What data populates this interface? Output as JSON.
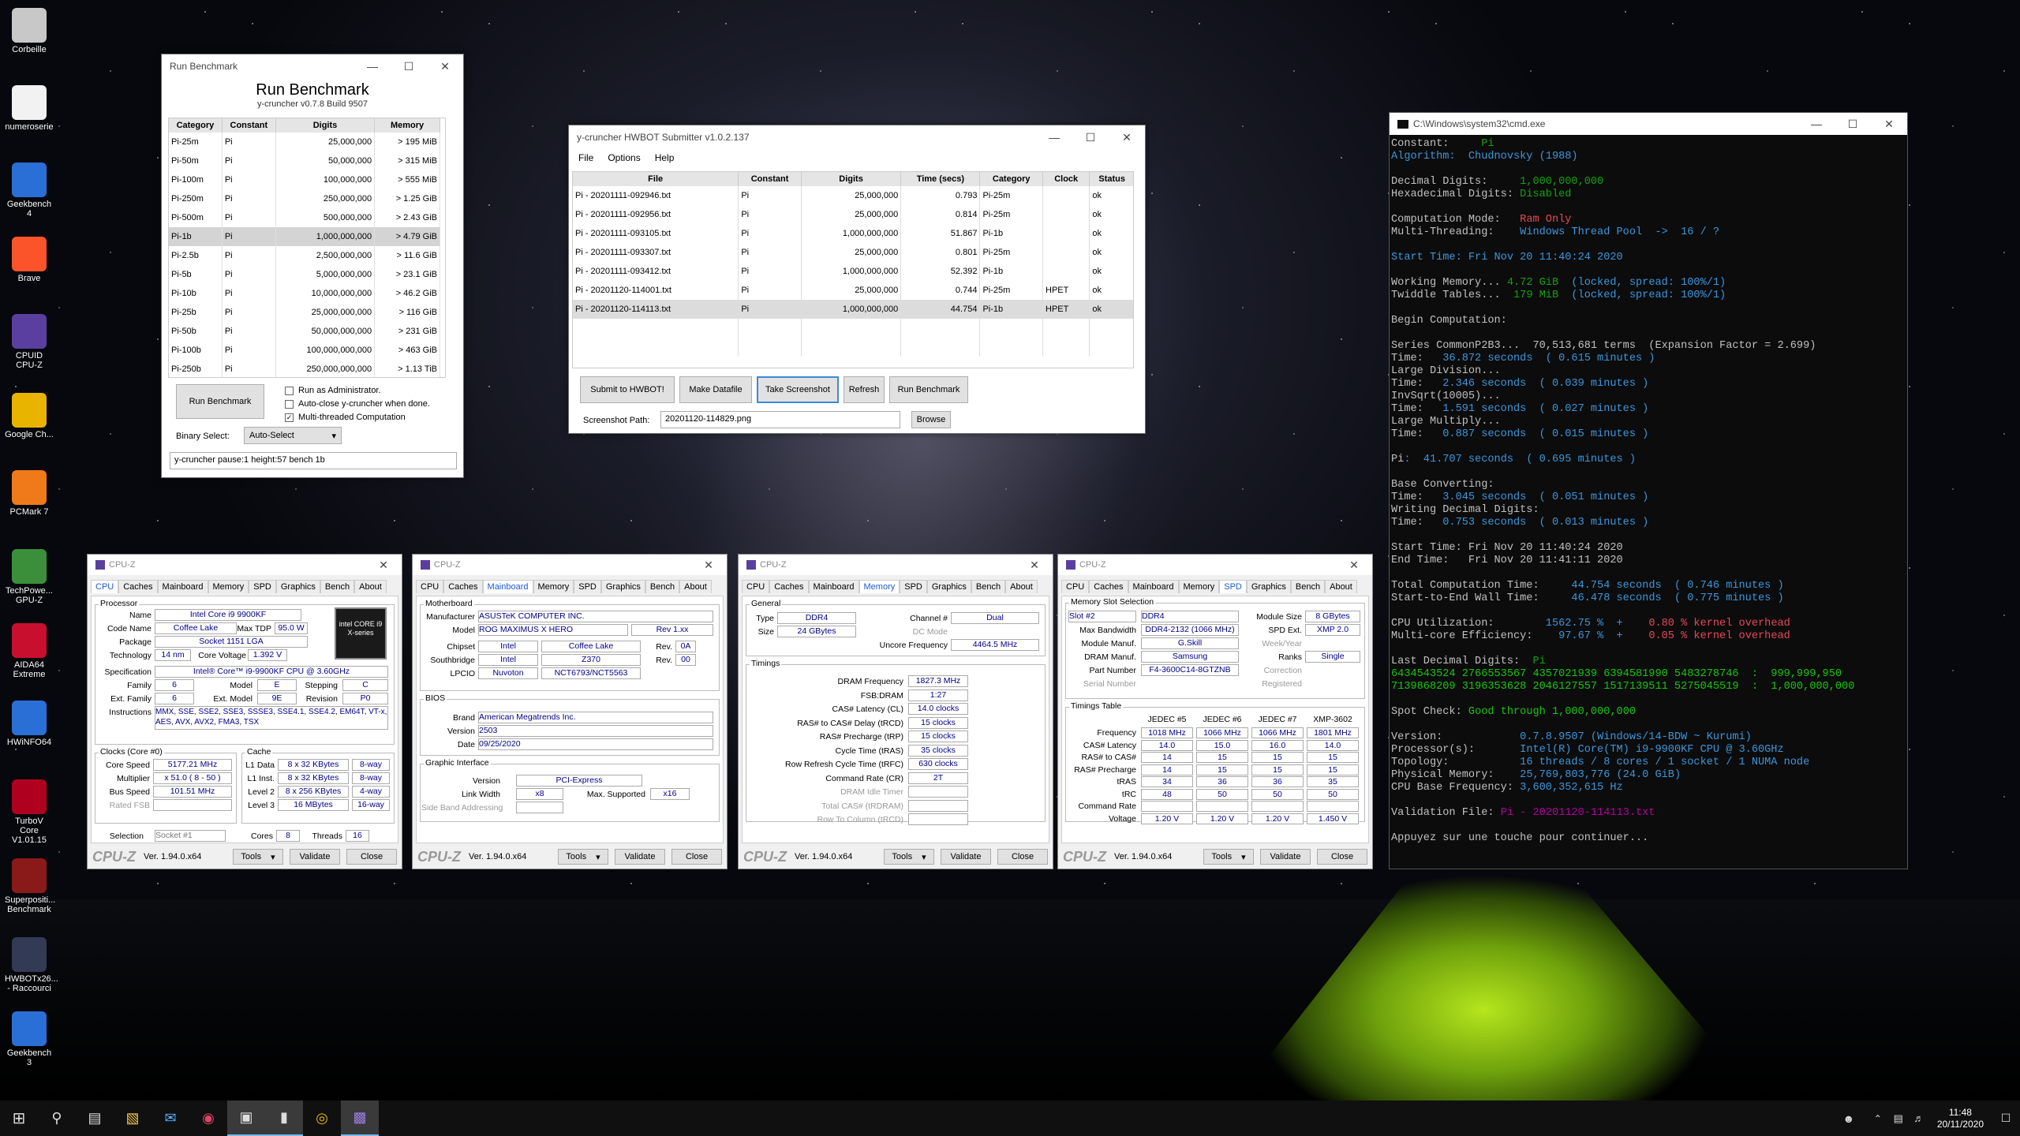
{
  "desktop_icons": [
    {
      "label": "Corbeille",
      "icon": "recycle-bin-icon",
      "color": "#c8c8c8"
    },
    {
      "label": "numeroserie",
      "icon": "document-icon",
      "color": "#f2f2f2"
    },
    {
      "label": "Geekbench 4",
      "icon": "geekbench-icon",
      "color": "#2a6fd6"
    },
    {
      "label": "Brave",
      "icon": "brave-icon",
      "color": "#fb542b"
    },
    {
      "label": "CPUID CPU-Z",
      "icon": "cpuz-icon",
      "color": "#5b3fa0"
    },
    {
      "label": "Google Ch...",
      "icon": "chrome-icon",
      "color": "#e8b400"
    },
    {
      "label": "PCMark 7",
      "icon": "pcmark-icon",
      "color": "#f07a1a"
    },
    {
      "label": "TechPowe... GPU-Z",
      "icon": "gpuz-icon",
      "color": "#3b8f3b"
    },
    {
      "label": "AIDA64 Extreme",
      "icon": "aida64-icon",
      "color": "#c8102e"
    },
    {
      "label": "HWiNFO64",
      "icon": "hwinfo-icon",
      "color": "#2a6fd6"
    },
    {
      "label": "TurboV Core V1.01.15",
      "icon": "turbov-icon",
      "color": "#b00020"
    },
    {
      "label": "Superpositi... Benchmark",
      "icon": "superposition-icon",
      "color": "#8a1a1a"
    },
    {
      "label": "HWBOTx26... - Raccourci",
      "icon": "hwbot-icon",
      "color": "#333a55"
    },
    {
      "label": "Geekbench 3",
      "icon": "geekbench3-icon",
      "color": "#2a6fd6"
    }
  ],
  "run_benchmark": {
    "window_title": "Run Benchmark",
    "heading": "Run Benchmark",
    "subheading": "y-cruncher v0.7.8 Build 9507",
    "columns": [
      "Category",
      "Constant",
      "Digits",
      "Memory"
    ],
    "rows": [
      [
        "Pi-25m",
        "Pi",
        "25,000,000",
        "> 195 MiB"
      ],
      [
        "Pi-50m",
        "Pi",
        "50,000,000",
        "> 315 MiB"
      ],
      [
        "Pi-100m",
        "Pi",
        "100,000,000",
        "> 555 MiB"
      ],
      [
        "Pi-250m",
        "Pi",
        "250,000,000",
        "> 1.25 GiB"
      ],
      [
        "Pi-500m",
        "Pi",
        "500,000,000",
        "> 2.43 GiB"
      ],
      [
        "Pi-1b",
        "Pi",
        "1,000,000,000",
        "> 4.79 GiB"
      ],
      [
        "Pi-2.5b",
        "Pi",
        "2,500,000,000",
        "> 11.6 GiB"
      ],
      [
        "Pi-5b",
        "Pi",
        "5,000,000,000",
        "> 23.1 GiB"
      ],
      [
        "Pi-10b",
        "Pi",
        "10,000,000,000",
        "> 46.2 GiB"
      ],
      [
        "Pi-25b",
        "Pi",
        "25,000,000,000",
        "> 116 GiB"
      ],
      [
        "Pi-50b",
        "Pi",
        "50,000,000,000",
        "> 231 GiB"
      ],
      [
        "Pi-100b",
        "Pi",
        "100,000,000,000",
        "> 463 GiB"
      ],
      [
        "Pi-250b",
        "Pi",
        "250,000,000,000",
        "> 1.13 TiB"
      ]
    ],
    "selected_row": 5,
    "run_button": "Run Benchmark",
    "opt_admin": "Run as Administrator.",
    "opt_autoclose": "Auto-close y-cruncher when done.",
    "opt_multithread": "Multi-threaded Computation",
    "binary_label": "Binary Select:",
    "binary_value": "Auto-Select",
    "command": "y-cruncher pause:1 height:57 bench 1b"
  },
  "hwbot": {
    "window_title": "y-cruncher HWBOT Submitter v1.0.2.137",
    "menu": [
      "File",
      "Options",
      "Help"
    ],
    "columns": [
      "File",
      "Constant",
      "Digits",
      "Time (secs)",
      "Category",
      "Clock",
      "Status"
    ],
    "rows": [
      [
        "Pi - 20201111-092946.txt",
        "Pi",
        "25,000,000",
        "0.793",
        "Pi-25m",
        "",
        "ok"
      ],
      [
        "Pi - 20201111-092956.txt",
        "Pi",
        "25,000,000",
        "0.814",
        "Pi-25m",
        "",
        "ok"
      ],
      [
        "Pi - 20201111-093105.txt",
        "Pi",
        "1,000,000,000",
        "51.867",
        "Pi-1b",
        "",
        "ok"
      ],
      [
        "Pi - 20201111-093307.txt",
        "Pi",
        "25,000,000",
        "0.801",
        "Pi-25m",
        "",
        "ok"
      ],
      [
        "Pi - 20201111-093412.txt",
        "Pi",
        "1,000,000,000",
        "52.392",
        "Pi-1b",
        "",
        "ok"
      ],
      [
        "Pi - 20201120-114001.txt",
        "Pi",
        "25,000,000",
        "0.744",
        "Pi-25m",
        "HPET",
        "ok"
      ],
      [
        "Pi - 20201120-114113.txt",
        "Pi",
        "1,000,000,000",
        "44.754",
        "Pi-1b",
        "HPET",
        "ok"
      ]
    ],
    "selected_row": 6,
    "buttons": [
      "Submit to HWBOT!",
      "Make Datafile",
      "Take Screenshot",
      "Refresh",
      "Run Benchmark"
    ],
    "path_label": "Screenshot Path:",
    "path_value": "20201120-114829.png",
    "browse": "Browse"
  },
  "cmd": {
    "window_title": "C:\\Windows\\system32\\cmd.exe",
    "lines": [
      [
        [
          "Constant:     ",
          ""
        ],
        [
          "Pi",
          "cg"
        ]
      ],
      [
        [
          "Algorithm:  Chudnovsky (1988)",
          "cy"
        ]
      ],
      [
        [
          "",
          ""
        ]
      ],
      [
        [
          "Decimal Digits:     ",
          ""
        ],
        [
          "1,000,000,000",
          "cg"
        ]
      ],
      [
        [
          "Hexadecimal Digits: ",
          ""
        ],
        [
          "Disabled",
          "cg"
        ]
      ],
      [
        [
          "",
          ""
        ]
      ],
      [
        [
          "Computation Mode:   ",
          ""
        ],
        [
          "Ram Only",
          "cr"
        ]
      ],
      [
        [
          "Multi-Threading:    ",
          ""
        ],
        [
          "Windows Thread Pool  ->  16 / ?",
          "cy"
        ]
      ],
      [
        [
          "",
          ""
        ]
      ],
      [
        [
          "Start Time: Fri Nov 20 11:40:24 2020",
          "cy"
        ]
      ],
      [
        [
          "",
          ""
        ]
      ],
      [
        [
          "Working Memory... ",
          ""
        ],
        [
          "4.72 GiB",
          "cg"
        ],
        [
          "  (locked, spread: 100%/1)",
          "cy"
        ]
      ],
      [
        [
          "Twiddle Tables... ",
          ""
        ],
        [
          " 179 MiB",
          "cg"
        ],
        [
          "  (locked, spread: 100%/1)",
          "cy"
        ]
      ],
      [
        [
          "",
          ""
        ]
      ],
      [
        [
          "Begin Computation:",
          ""
        ]
      ],
      [
        [
          "",
          ""
        ]
      ],
      [
        [
          "Series CommonP2B3...  70,513,681 terms  (Expansion Factor = 2.699)",
          ""
        ]
      ],
      [
        [
          "Time:   ",
          ""
        ],
        [
          "36.872 seconds  ( 0.615 minutes )",
          "cy"
        ]
      ],
      [
        [
          "Large Division...",
          ""
        ]
      ],
      [
        [
          "Time:   ",
          ""
        ],
        [
          "2.346 seconds  ( 0.039 minutes )",
          "cy"
        ]
      ],
      [
        [
          "InvSqrt(10005)...",
          ""
        ]
      ],
      [
        [
          "Time:   ",
          ""
        ],
        [
          "1.591 seconds  ( 0.027 minutes )",
          "cy"
        ]
      ],
      [
        [
          "Large Multiply...",
          ""
        ]
      ],
      [
        [
          "Time:   ",
          ""
        ],
        [
          "0.887 seconds  ( 0.015 minutes )",
          "cy"
        ]
      ],
      [
        [
          "",
          ""
        ]
      ],
      [
        [
          "Pi",
          ""
        ],
        [
          ":  41.707 seconds  ( 0.695 minutes )",
          "cy"
        ]
      ],
      [
        [
          "",
          ""
        ]
      ],
      [
        [
          "Base Converting:",
          ""
        ]
      ],
      [
        [
          "Time:   ",
          ""
        ],
        [
          "3.045 seconds  ( 0.051 minutes )",
          "cy"
        ]
      ],
      [
        [
          "Writing Decimal Digits:",
          ""
        ]
      ],
      [
        [
          "Time:   ",
          ""
        ],
        [
          "0.753 seconds  ( 0.013 minutes )",
          "cy"
        ]
      ],
      [
        [
          "",
          ""
        ]
      ],
      [
        [
          "Start Time: Fri Nov 20 11:40:24 2020",
          ""
        ]
      ],
      [
        [
          "End Time:   Fri Nov 20 11:41:11 2020",
          ""
        ]
      ],
      [
        [
          "",
          ""
        ]
      ],
      [
        [
          "Total Computation Time:     ",
          ""
        ],
        [
          "44.754 seconds  ( 0.746 minutes )",
          "cy"
        ]
      ],
      [
        [
          "Start-to-End Wall Time:     ",
          ""
        ],
        [
          "46.478 seconds  ( 0.775 minutes )",
          "cy"
        ]
      ],
      [
        [
          "",
          ""
        ]
      ],
      [
        [
          "CPU Utilization:        ",
          ""
        ],
        [
          "1562.75 %  +    ",
          "cy"
        ],
        [
          "0.80 % kernel overhead",
          "cr"
        ]
      ],
      [
        [
          "Multi-core Efficiency:    ",
          ""
        ],
        [
          "97.67 %  +    ",
          "cy"
        ],
        [
          "0.05 % kernel overhead",
          "cr"
        ]
      ],
      [
        [
          "",
          ""
        ]
      ],
      [
        [
          "Last Decimal Digits:  ",
          ""
        ],
        [
          "Pi",
          "cg"
        ]
      ],
      [
        [
          "6434543524 2766553567 4357021939 6394581990 5483278746  :  999,999,950",
          "cgg"
        ]
      ],
      [
        [
          "7139868209 3196353628 2046127557 1517139511 5275045519  :  1,000,000,000",
          "cgg"
        ]
      ],
      [
        [
          "",
          ""
        ]
      ],
      [
        [
          "Spot Check: ",
          ""
        ],
        [
          "Good through 1,000,000,000",
          "cgg"
        ]
      ],
      [
        [
          "",
          ""
        ]
      ],
      [
        [
          "Version:            ",
          ""
        ],
        [
          "0.7.8.9507 (Windows/14-BDW ~ Kurumi)",
          "cy"
        ]
      ],
      [
        [
          "Processor(s):       ",
          ""
        ],
        [
          "Intel(R) Core(TM) i9-9900KF CPU @ 3.60GHz",
          "cy"
        ]
      ],
      [
        [
          "Topology:           ",
          ""
        ],
        [
          "16 threads / 8 cores / 1 socket / 1 NUMA node",
          "cy"
        ]
      ],
      [
        [
          "Physical Memory:    ",
          ""
        ],
        [
          "25,769,803,776 (24.0 GiB)",
          "cy"
        ]
      ],
      [
        [
          "CPU Base Frequency: ",
          ""
        ],
        [
          "3,600,352,615 Hz",
          "cy"
        ]
      ],
      [
        [
          "",
          ""
        ]
      ],
      [
        [
          "Validation File: ",
          ""
        ],
        [
          "Pi - 20201120-114113.txt",
          "cm"
        ]
      ],
      [
        [
          "",
          ""
        ]
      ],
      [
        [
          "Appuyez sur une touche pour continuer...",
          ""
        ]
      ]
    ]
  },
  "cpuz": {
    "title": "CPU-Z",
    "tabs": [
      "CPU",
      "Caches",
      "Mainboard",
      "Memory",
      "SPD",
      "Graphics",
      "Bench",
      "About"
    ],
    "version": "Ver. 1.94.0.x64",
    "tools": "Tools",
    "validate": "Validate",
    "close": "Close",
    "cpu": {
      "processor": "Processor",
      "name_l": "Name",
      "name": "Intel Core i9 9900KF",
      "codename_l": "Code Name",
      "codename": "Coffee Lake",
      "tdp_l": "Max TDP",
      "tdp": "95.0 W",
      "package_l": "Package",
      "package": "Socket 1151 LGA",
      "tech_l": "Technology",
      "tech": "14 nm",
      "voltage_l": "Core Voltage",
      "voltage": "1.392 V",
      "spec_l": "Specification",
      "spec": "Intel® Core™ i9-9900KF CPU @ 3.60GHz",
      "family_l": "Family",
      "family": "6",
      "model_l": "Model",
      "model": "E",
      "stepping_l": "Stepping",
      "stepping": "C",
      "extfam_l": "Ext. Family",
      "extfam": "6",
      "extmodel_l": "Ext. Model",
      "extmodel": "9E",
      "revision_l": "Revision",
      "revision": "P0",
      "instr_l": "Instructions",
      "instr": "MMX, SSE, SSE2, SSE3, SSSE3, SSE4.1, SSE4.2, EM64T, VT-x, AES, AVX, AVX2, FMA3, TSX",
      "clocks": "Clocks (Core #0)",
      "corespeed_l": "Core Speed",
      "corespeed": "5177.21 MHz",
      "mult_l": "Multiplier",
      "mult": "x 51.0 ( 8 - 50 )",
      "bus_l": "Bus Speed",
      "bus": "101.51 MHz",
      "ratedfsb_l": "Rated FSB",
      "cache": "Cache",
      "l1d_l": "L1 Data",
      "l1d": "8 x 32 KBytes",
      "l1d_w": "8-way",
      "l1i_l": "L1 Inst.",
      "l1i": "8 x 32 KBytes",
      "l1i_w": "8-way",
      "l2_l": "Level 2",
      "l2": "8 x 256 KBytes",
      "l2_w": "4-way",
      "l3_l": "Level 3",
      "l3": "16 MBytes",
      "l3_w": "16-way",
      "sel_l": "Selection",
      "sel": "Socket #1",
      "cores_l": "Cores",
      "cores": "8",
      "threads_l": "Threads",
      "threads": "16",
      "logo": "intel CORE i9 X-series"
    },
    "mb": {
      "group": "Motherboard",
      "manuf_l": "Manufacturer",
      "manuf": "ASUSTeK COMPUTER INC.",
      "model_l": "Model",
      "model": "ROG MAXIMUS X HERO",
      "rev": "Rev 1.xx",
      "chipset_l": "Chipset",
      "chipset": "Intel",
      "chipset2": "Coffee Lake",
      "rev_l": "Rev.",
      "chipset_rev": "0A",
      "south_l": "Southbridge",
      "south": "Intel",
      "south2": "Z370",
      "south_rev": "00",
      "lpcio_l": "LPCIO",
      "lpcio": "Nuvoton",
      "lpcio2": "NCT6793/NCT5563",
      "bios": "BIOS",
      "brand_l": "Brand",
      "brand": "American Megatrends Inc.",
      "version_l": "Version",
      "version": "2503",
      "date_l": "Date",
      "date": "09/25/2020",
      "gi": "Graphic Interface",
      "giver_l": "Version",
      "giver": "PCI-Express",
      "lw_l": "Link Width",
      "lw": "x8",
      "ms_l": "Max. Supported",
      "ms": "x16",
      "sba_l": "Side Band Addressing"
    },
    "mem": {
      "general": "General",
      "type_l": "Type",
      "type": "DDR4",
      "ch_l": "Channel #",
      "ch": "Dual",
      "size_l": "Size",
      "size": "24 GBytes",
      "dc_l": "DC Mode",
      "unc_l": "Uncore Frequency",
      "unc": "4464.5 MHz",
      "timings": "Timings",
      "rows": [
        [
          "DRAM Frequency",
          "1827.3 MHz"
        ],
        [
          "FSB:DRAM",
          "1:27"
        ],
        [
          "CAS# Latency (CL)",
          "14.0 clocks"
        ],
        [
          "RAS# to CAS# Delay (tRCD)",
          "15 clocks"
        ],
        [
          "RAS# Precharge (tRP)",
          "15 clocks"
        ],
        [
          "Cycle Time (tRAS)",
          "35 clocks"
        ],
        [
          "Row Refresh Cycle Time (tRFC)",
          "630 clocks"
        ],
        [
          "Command Rate (CR)",
          "2T"
        ],
        [
          "DRAM Idle Timer",
          ""
        ],
        [
          "Total CAS# (tRDRAM)",
          ""
        ],
        [
          "Row To Column (tRCD)",
          ""
        ]
      ]
    },
    "spd": {
      "group": "Memory Slot Selection",
      "slot": "Slot #2",
      "type": "DDR4",
      "modsize_l": "Module Size",
      "modsize": "8 GBytes",
      "maxbw_l": "Max Bandwidth",
      "maxbw": "DDR4-2132 (1066 MHz)",
      "spdext_l": "SPD Ext.",
      "spdext": "XMP 2.0",
      "modmanuf_l": "Module Manuf.",
      "modmanuf": "G.Skill",
      "wy_l": "Week/Year",
      "drammanuf_l": "DRAM Manuf.",
      "drammanuf": "Samsung",
      "ranks_l": "Ranks",
      "ranks": "Single",
      "part_l": "Part Number",
      "part": "F4-3600C14-8GTZNB",
      "corr_l": "Correction",
      "serial_l": "Serial Number",
      "reg_l": "Registered",
      "tt": "Timings Table",
      "cols": [
        "JEDEC #5",
        "JEDEC #6",
        "JEDEC #7",
        "XMP-3602"
      ],
      "rows": [
        [
          "Frequency",
          "1018 MHz",
          "1066 MHz",
          "1066 MHz",
          "1801 MHz"
        ],
        [
          "CAS# Latency",
          "14.0",
          "15.0",
          "16.0",
          "14.0"
        ],
        [
          "RAS# to CAS#",
          "14",
          "15",
          "15",
          "15"
        ],
        [
          "RAS# Precharge",
          "14",
          "15",
          "15",
          "15"
        ],
        [
          "tRAS",
          "34",
          "36",
          "36",
          "35"
        ],
        [
          "tRC",
          "48",
          "50",
          "50",
          "50"
        ],
        [
          "Command Rate",
          "",
          "",
          "",
          ""
        ],
        [
          "Voltage",
          "1.20 V",
          "1.20 V",
          "1.20 V",
          "1.450 V"
        ]
      ]
    }
  },
  "taskbar": {
    "time": "11:48",
    "date": "20/11/2020"
  }
}
